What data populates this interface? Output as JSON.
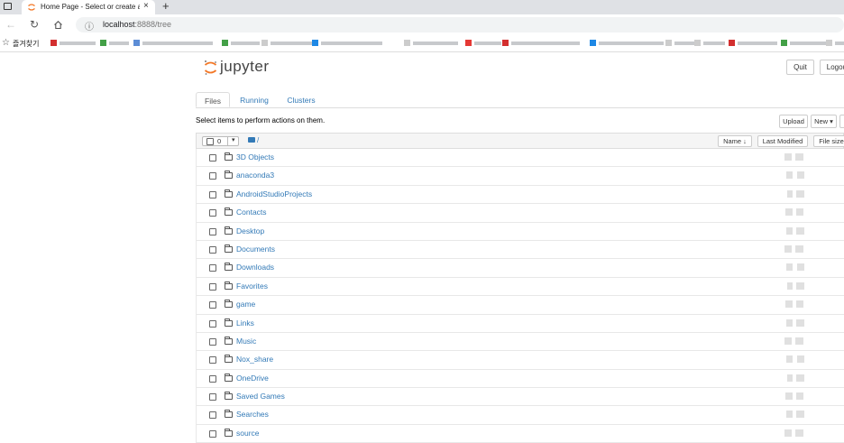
{
  "browser": {
    "tab_title": "Home Page - Select or create a n",
    "url_host": "localhost",
    "url_path": ":8888/tree",
    "bookmarks_label": "즐겨찾기",
    "colors": {
      "tabbar": "#dfe1e5",
      "jupyter_orange": "#f37726"
    }
  },
  "header": {
    "logo_text": "jupyter",
    "quit_label": "Quit",
    "logout_label": "Logout"
  },
  "tabs": [
    {
      "label": "Files",
      "active": true
    },
    {
      "label": "Running",
      "active": false
    },
    {
      "label": "Clusters",
      "active": false
    }
  ],
  "toolbar": {
    "select_info": "Select items to perform actions on them.",
    "upload_label": "Upload",
    "new_label": "New ▾"
  },
  "list_header": {
    "selected_count": "0",
    "path": "/",
    "sort_name": "Name ↓",
    "sort_last_modified": "Last Modified",
    "sort_file_size": "File size"
  },
  "items": [
    {
      "name": "3D Objects"
    },
    {
      "name": "anaconda3"
    },
    {
      "name": "AndroidStudioProjects"
    },
    {
      "name": "Contacts"
    },
    {
      "name": "Desktop"
    },
    {
      "name": "Documents"
    },
    {
      "name": "Downloads"
    },
    {
      "name": "Favorites"
    },
    {
      "name": "game"
    },
    {
      "name": "Links"
    },
    {
      "name": "Music"
    },
    {
      "name": "Nox_share"
    },
    {
      "name": "OneDrive"
    },
    {
      "name": "Saved Games"
    },
    {
      "name": "Searches"
    },
    {
      "name": "source"
    }
  ]
}
